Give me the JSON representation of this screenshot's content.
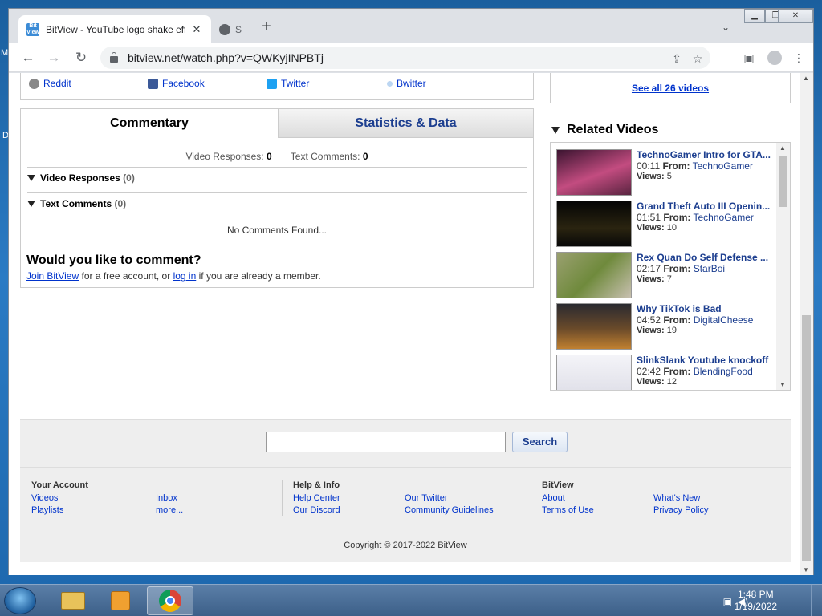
{
  "browser": {
    "active_tab_title": "BitView - YouTube logo shake eff",
    "active_tab_favicon_text": "Bit View",
    "inactive_tab_letter": "S",
    "url": "bitview.net/watch.php?v=QWKyjINPBTj"
  },
  "share": {
    "items": [
      {
        "label": "Reddit",
        "color": "#5f6368"
      },
      {
        "label": "Facebook",
        "color": "#3b5998"
      },
      {
        "label": "Twitter",
        "color": "#1da1f2"
      },
      {
        "label": "Bwitter",
        "color": "#7fb3e6"
      }
    ]
  },
  "comments": {
    "tab_commentary": "Commentary",
    "tab_stats": "Statistics & Data",
    "video_responses_label": "Video Responses:",
    "video_responses_count": "0",
    "text_comments_label": "Text Comments:",
    "text_comments_count": "0",
    "section_video_responses": "Video Responses",
    "section_video_responses_num": "(0)",
    "section_text_comments": "Text Comments",
    "section_text_comments_num": "(0)",
    "no_comments": "No Comments Found...",
    "prompt": "Would you like to comment?",
    "join_link": "Join BitView",
    "join_mid": "for a free account, or",
    "login_link": "log in",
    "join_end": "if you are already a member."
  },
  "related": {
    "see_all": "See all 26 videos",
    "heading": "Related Videos",
    "from_label": "From:",
    "views_label": "Views:",
    "items": [
      {
        "title": "TechnoGamer Intro for GTA...",
        "duration": "00:11",
        "user": "TechnoGamer",
        "views": "5",
        "thumb": "#b03a6e"
      },
      {
        "title": "Grand Theft Auto III Openin...",
        "duration": "01:51",
        "user": "TechnoGamer",
        "views": "10",
        "thumb": "#1a1a1a"
      },
      {
        "title": "Rex Quan Do Self Defense ...",
        "duration": "02:17",
        "user": "StarBoi",
        "views": "7",
        "thumb": "#7d8a4a"
      },
      {
        "title": "Why TikTok is Bad",
        "duration": "04:52",
        "user": "DigitalCheese",
        "views": "19",
        "thumb": "#8a5a2a"
      },
      {
        "title": "SlinkSlank Youtube knockoff",
        "duration": "02:42",
        "user": "BlendingFood",
        "views": "12",
        "thumb": "#e8e8ee"
      }
    ]
  },
  "footer": {
    "search_button": "Search",
    "search_placeholder": "",
    "col1_head": "Your Account",
    "col1_links": [
      "Videos",
      "Inbox",
      "Playlists",
      "more..."
    ],
    "col2_head": "Help & Info",
    "col2_links": [
      "Help Center",
      "Our Twitter",
      "Our Discord",
      "Community Guidelines"
    ],
    "col3_head": "BitView",
    "col3_links": [
      "About",
      "What's New",
      "Terms of Use",
      "Privacy Policy"
    ],
    "copyright": "Copyright © 2017-2022 BitView"
  },
  "taskbar": {
    "time": "1:48 PM",
    "date": "1/19/2022"
  },
  "desktop": {
    "left_letters": [
      "M",
      "D"
    ]
  }
}
